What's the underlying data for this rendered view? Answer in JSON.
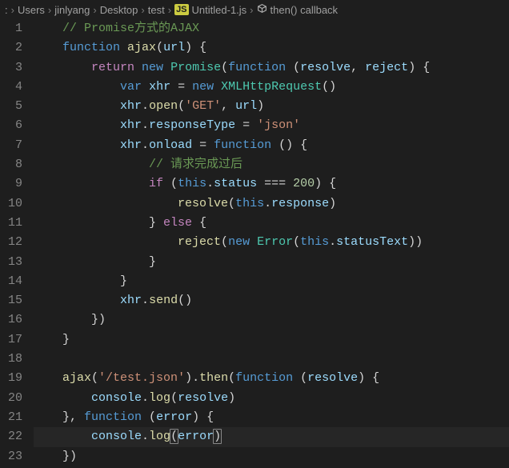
{
  "breadcrumb": {
    "items": [
      "Users",
      "jinlyang",
      "Desktop",
      "test"
    ],
    "file_icon_text": "JS",
    "file": "Untitled-1.js",
    "symbol_icon": "cube",
    "symbol": "then() callback"
  },
  "editor": {
    "line_start": 1,
    "line_end": 23,
    "highlighted_line": 22,
    "lines": [
      {
        "type": "comment",
        "indent": 1,
        "text": "// Promise方式的AJAX"
      },
      {
        "type": "code",
        "indent": 1,
        "tokens": [
          [
            "keyword",
            "function"
          ],
          [
            "punct",
            " "
          ],
          [
            "func",
            "ajax"
          ],
          [
            "punct",
            "("
          ],
          [
            "var",
            "url"
          ],
          [
            "punct",
            ") {"
          ]
        ]
      },
      {
        "type": "code",
        "indent": 2,
        "tokens": [
          [
            "keyword2",
            "return"
          ],
          [
            "punct",
            " "
          ],
          [
            "keyword",
            "new"
          ],
          [
            "punct",
            " "
          ],
          [
            "type",
            "Promise"
          ],
          [
            "punct",
            "("
          ],
          [
            "keyword",
            "function"
          ],
          [
            "punct",
            " ("
          ],
          [
            "var",
            "resolve"
          ],
          [
            "punct",
            ", "
          ],
          [
            "var",
            "reject"
          ],
          [
            "punct",
            ") {"
          ]
        ]
      },
      {
        "type": "code",
        "indent": 3,
        "tokens": [
          [
            "keyword",
            "var"
          ],
          [
            "punct",
            " "
          ],
          [
            "var",
            "xhr"
          ],
          [
            "punct",
            " = "
          ],
          [
            "keyword",
            "new"
          ],
          [
            "punct",
            " "
          ],
          [
            "type",
            "XMLHttpRequest"
          ],
          [
            "punct",
            "()"
          ]
        ]
      },
      {
        "type": "code",
        "indent": 3,
        "tokens": [
          [
            "var",
            "xhr"
          ],
          [
            "punct",
            "."
          ],
          [
            "func",
            "open"
          ],
          [
            "punct",
            "("
          ],
          [
            "string",
            "'GET'"
          ],
          [
            "punct",
            ", "
          ],
          [
            "var",
            "url"
          ],
          [
            "punct",
            ")"
          ]
        ]
      },
      {
        "type": "code",
        "indent": 3,
        "tokens": [
          [
            "var",
            "xhr"
          ],
          [
            "punct",
            "."
          ],
          [
            "prop",
            "responseType"
          ],
          [
            "punct",
            " = "
          ],
          [
            "string",
            "'json'"
          ]
        ]
      },
      {
        "type": "code",
        "indent": 3,
        "tokens": [
          [
            "var",
            "xhr"
          ],
          [
            "punct",
            "."
          ],
          [
            "prop",
            "onload"
          ],
          [
            "punct",
            " = "
          ],
          [
            "keyword",
            "function"
          ],
          [
            "punct",
            " () {"
          ]
        ]
      },
      {
        "type": "comment",
        "indent": 4,
        "text": "// 请求完成过后"
      },
      {
        "type": "code",
        "indent": 4,
        "tokens": [
          [
            "keyword2",
            "if"
          ],
          [
            "punct",
            " ("
          ],
          [
            "keyword",
            "this"
          ],
          [
            "punct",
            "."
          ],
          [
            "prop",
            "status"
          ],
          [
            "punct",
            " === "
          ],
          [
            "num",
            "200"
          ],
          [
            "punct",
            ") {"
          ]
        ]
      },
      {
        "type": "code",
        "indent": 5,
        "tokens": [
          [
            "func",
            "resolve"
          ],
          [
            "punct",
            "("
          ],
          [
            "keyword",
            "this"
          ],
          [
            "punct",
            "."
          ],
          [
            "prop",
            "response"
          ],
          [
            "punct",
            ")"
          ]
        ]
      },
      {
        "type": "code",
        "indent": 4,
        "tokens": [
          [
            "punct",
            "} "
          ],
          [
            "keyword2",
            "else"
          ],
          [
            "punct",
            " {"
          ]
        ]
      },
      {
        "type": "code",
        "indent": 5,
        "tokens": [
          [
            "func",
            "reject"
          ],
          [
            "punct",
            "("
          ],
          [
            "keyword",
            "new"
          ],
          [
            "punct",
            " "
          ],
          [
            "type",
            "Error"
          ],
          [
            "punct",
            "("
          ],
          [
            "keyword",
            "this"
          ],
          [
            "punct",
            "."
          ],
          [
            "prop",
            "statusText"
          ],
          [
            "punct",
            "))"
          ]
        ]
      },
      {
        "type": "code",
        "indent": 4,
        "tokens": [
          [
            "punct",
            "}"
          ]
        ]
      },
      {
        "type": "code",
        "indent": 3,
        "tokens": [
          [
            "punct",
            "}"
          ]
        ]
      },
      {
        "type": "code",
        "indent": 3,
        "tokens": [
          [
            "var",
            "xhr"
          ],
          [
            "punct",
            "."
          ],
          [
            "func",
            "send"
          ],
          [
            "punct",
            "()"
          ]
        ]
      },
      {
        "type": "code",
        "indent": 2,
        "tokens": [
          [
            "punct",
            "})"
          ]
        ]
      },
      {
        "type": "code",
        "indent": 1,
        "tokens": [
          [
            "punct",
            "}"
          ]
        ]
      },
      {
        "type": "blank",
        "indent": 0
      },
      {
        "type": "code",
        "indent": 1,
        "tokens": [
          [
            "func",
            "ajax"
          ],
          [
            "punct",
            "("
          ],
          [
            "string",
            "'/test.json'"
          ],
          [
            "punct",
            ")."
          ],
          [
            "func",
            "then"
          ],
          [
            "punct",
            "("
          ],
          [
            "keyword",
            "function"
          ],
          [
            "punct",
            " ("
          ],
          [
            "var",
            "resolve"
          ],
          [
            "punct",
            ") {"
          ]
        ]
      },
      {
        "type": "code",
        "indent": 2,
        "tokens": [
          [
            "var",
            "console"
          ],
          [
            "punct",
            "."
          ],
          [
            "func",
            "log"
          ],
          [
            "punct",
            "("
          ],
          [
            "var",
            "resolve"
          ],
          [
            "punct",
            ")"
          ]
        ]
      },
      {
        "type": "code",
        "indent": 1,
        "tokens": [
          [
            "punct",
            "}, "
          ],
          [
            "keyword",
            "function"
          ],
          [
            "punct",
            " ("
          ],
          [
            "var",
            "error"
          ],
          [
            "punct",
            ") {"
          ]
        ]
      },
      {
        "type": "code",
        "indent": 2,
        "hl": true,
        "tokens": [
          [
            "var",
            "console"
          ],
          [
            "punct",
            "."
          ],
          [
            "func",
            "log"
          ],
          [
            "punct-b",
            "("
          ],
          [
            "var",
            "error"
          ],
          [
            "punct-b",
            ")"
          ]
        ]
      },
      {
        "type": "code",
        "indent": 1,
        "tokens": [
          [
            "punct",
            "})"
          ]
        ]
      }
    ]
  }
}
